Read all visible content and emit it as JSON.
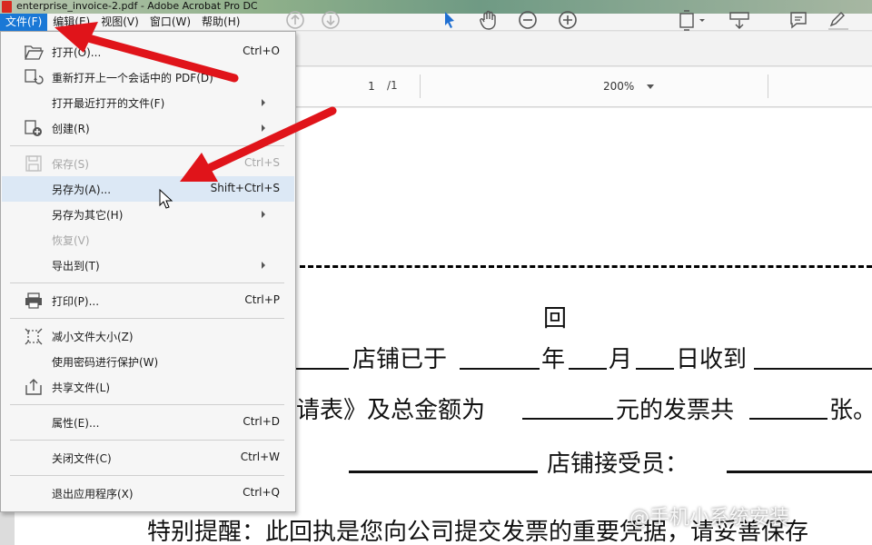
{
  "window": {
    "title": "enterprise_invoice-2.pdf - Adobe Acrobat Pro DC"
  },
  "menubar": {
    "items": [
      {
        "label": "文件(F)"
      },
      {
        "label": "编辑(E)"
      },
      {
        "label": "视图(V)"
      },
      {
        "label": "窗口(W)"
      },
      {
        "label": "帮助(H)"
      }
    ]
  },
  "toolbar": {
    "page_current": "1",
    "page_total": "/1",
    "zoom": "200%"
  },
  "file_menu": {
    "open": {
      "label": "打开(O)...",
      "shortcut": "Ctrl+O"
    },
    "reopen": {
      "label": "重新打开上一个会话中的 PDF(D)"
    },
    "recent": {
      "label": "打开最近打开的文件(F)"
    },
    "create": {
      "label": "创建(R)"
    },
    "save": {
      "label": "保存(S)",
      "shortcut": "Ctrl+S"
    },
    "save_as": {
      "label": "另存为(A)...",
      "shortcut": "Shift+Ctrl+S"
    },
    "save_as_other": {
      "label": "另存为其它(H)"
    },
    "revert": {
      "label": "恢复(V)"
    },
    "export_to": {
      "label": "导出到(T)"
    },
    "print": {
      "label": "打印(P)...",
      "shortcut": "Ctrl+P"
    },
    "reduce_size": {
      "label": "减小文件大小(Z)"
    },
    "protect": {
      "label": "使用密码进行保护(W)"
    },
    "share": {
      "label": "共享文件(L)"
    },
    "properties": {
      "label": "属性(E)...",
      "shortcut": "Ctrl+D"
    },
    "close": {
      "label": "关闭文件(C)",
      "shortcut": "Ctrl+W"
    },
    "exit": {
      "label": "退出应用程序(X)",
      "shortcut": "Ctrl+Q"
    }
  },
  "document": {
    "heading": "回",
    "line1_a": "店铺已于",
    "line1_b": "年",
    "line1_c": "月",
    "line1_d": "日收到",
    "line2_a": "申请表》及总金额为",
    "line2_b": "元的发票共",
    "line2_c": "张。",
    "line3": "店铺接受员：",
    "line4": "特别提醒：此回执是您向公司提交发票的重要凭据，请妥善保存"
  },
  "watermark": "@手机小系统安装"
}
